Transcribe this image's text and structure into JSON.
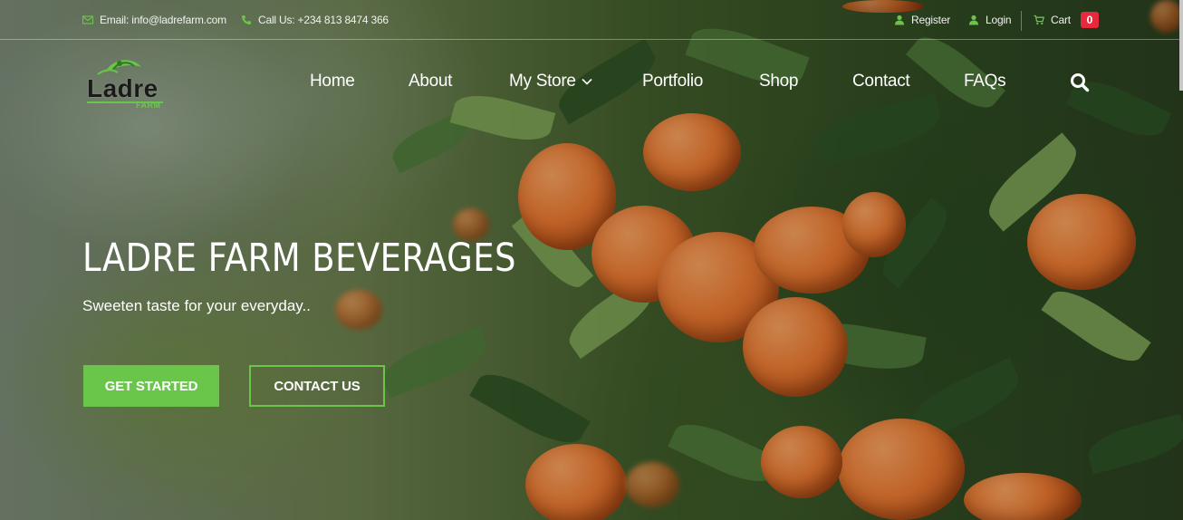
{
  "topbar": {
    "email": "Email: info@ladrefarm.com",
    "phone": "Call Us: +234 813 8474 366",
    "register": "Register",
    "login": "Login",
    "cart": "Cart",
    "cart_count": "0"
  },
  "brand": {
    "name": "Ladre",
    "sub": "FARM",
    "accent": "#6ac64a"
  },
  "nav": {
    "items": [
      "Home",
      "About",
      "My Store",
      "Portfolio",
      "Shop",
      "Contact",
      "FAQs"
    ]
  },
  "hero": {
    "title": "LADRE FARM BEVERAGES",
    "subtitle": "Sweeten taste for your everyday..",
    "cta_primary": "GET STARTED",
    "cta_secondary": "CONTACT US"
  },
  "colors": {
    "accent": "#6ac64a",
    "badge": "#e8283c"
  },
  "icons": {
    "email": "envelope-icon",
    "phone": "phone-icon",
    "register": "user-icon",
    "login": "user-icon",
    "cart": "cart-icon",
    "search": "search-icon",
    "dropdown": "chevron-down-icon"
  }
}
